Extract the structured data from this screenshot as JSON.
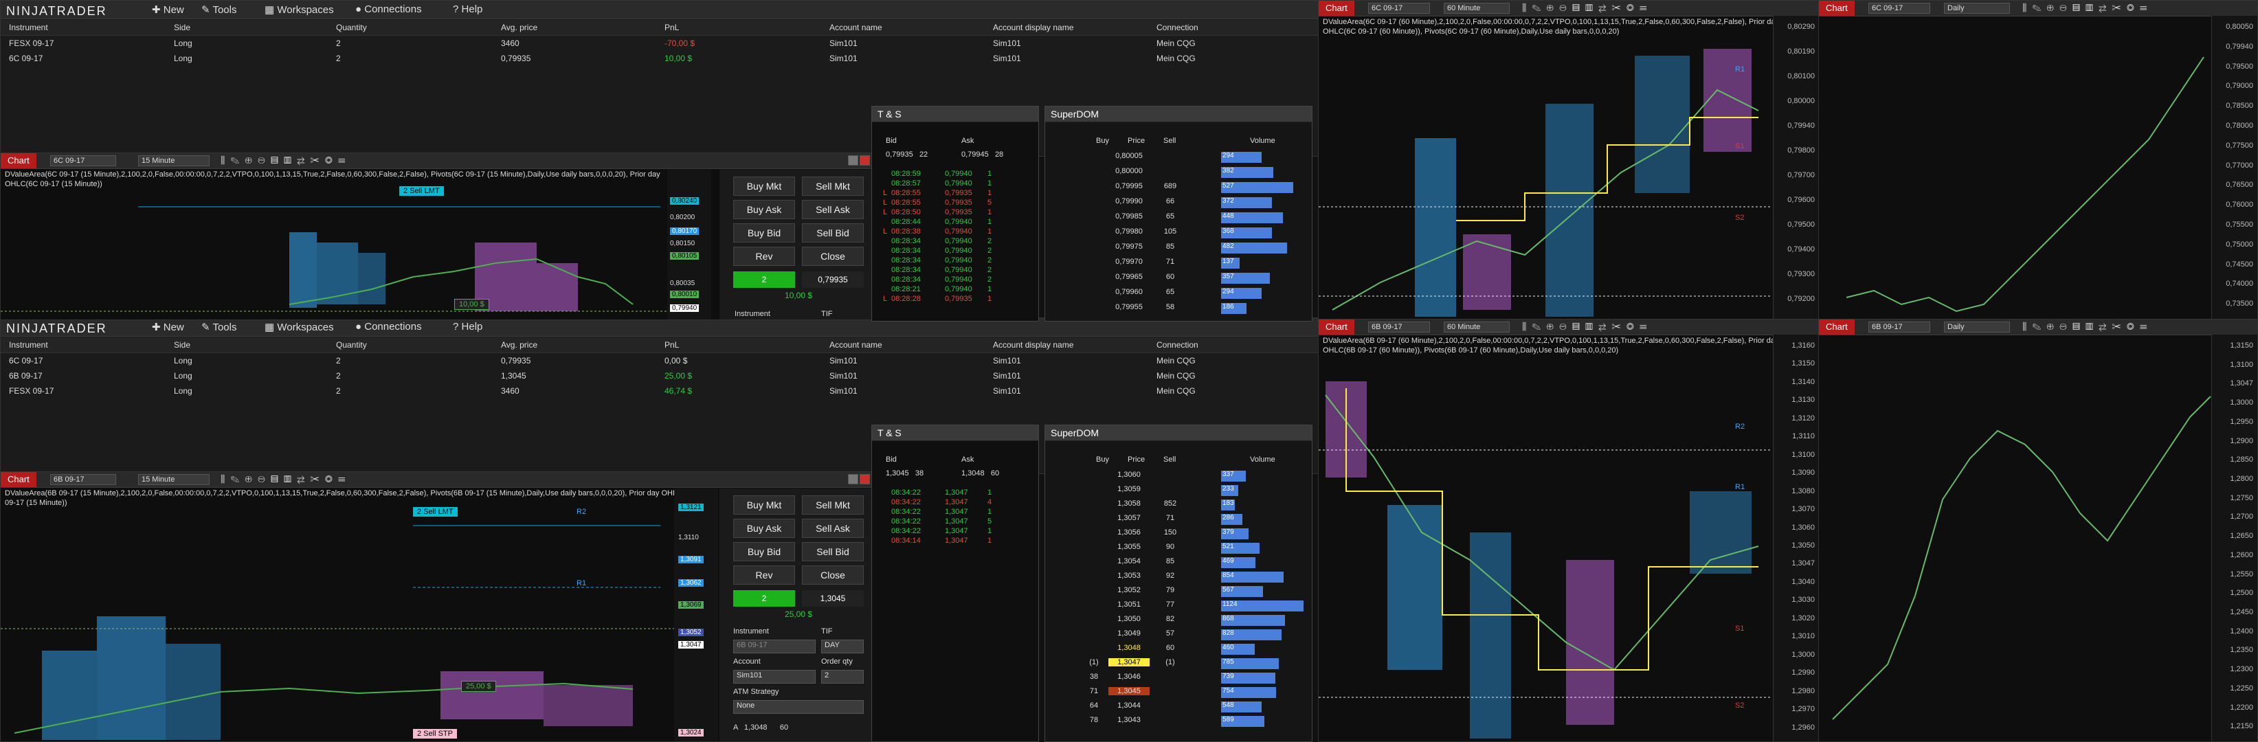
{
  "app": {
    "logo": "NINJATRADER"
  },
  "menu": {
    "new": "New",
    "tools": "Tools",
    "workspaces": "Workspaces",
    "connections": "Connections",
    "help": "Help"
  },
  "positions_columns": [
    "Instrument",
    "Side",
    "Quantity",
    "Avg. price",
    "PnL",
    "Account name",
    "Account display name",
    "Connection"
  ],
  "positions_top": [
    {
      "instrument": "FESX 09-17",
      "side": "Long",
      "qty": "2",
      "avg": "3460",
      "pnl": "-70,00 $",
      "account": "Sim101",
      "display": "Sim101",
      "conn": "Mein CQG"
    },
    {
      "instrument": "6C 09-17",
      "side": "Long",
      "qty": "2",
      "avg": "0,79935",
      "pnl": "10,00 $",
      "account": "Sim101",
      "display": "Sim101",
      "conn": "Mein CQG"
    }
  ],
  "positions_bottom": [
    {
      "instrument": "6C 09-17",
      "side": "Long",
      "qty": "2",
      "avg": "0,79935",
      "pnl": "0,00 $",
      "account": "Sim101",
      "display": "Sim101",
      "conn": "Mein CQG"
    },
    {
      "instrument": "6B 09-17",
      "side": "Long",
      "qty": "2",
      "avg": "1,3045",
      "pnl": "25,00 $",
      "account": "Sim101",
      "display": "Sim101",
      "conn": "Mein CQG"
    },
    {
      "instrument": "FESX 09-17",
      "side": "Long",
      "qty": "2",
      "avg": "3460",
      "pnl": "46,74 $",
      "account": "Sim101",
      "display": "Sim101",
      "conn": "Mein CQG"
    }
  ],
  "chart_tag": "Chart",
  "chart_tl": {
    "instrument": "6C 09-17",
    "interval": "15 Minute",
    "info1": "DValueArea(6C 09-17 (15 Minute),2,100,2,0,False,00:00:00,0,7,2,2,VTPO,0,100,1,13,15,True,2,False,0,60,300,False,2,False), Pivots(6C 09-17 (15 Minute),Daily,Use daily bars,0,0,0,20), Prior day",
    "info2": "OHLC(6C 09-17 (15 Minute))",
    "order_label": "2 Sell LMT",
    "pnl_label": "10,00 $",
    "axis": [
      "0,80240",
      "0,80200",
      "0,80170",
      "0,80150",
      "0,80105",
      "0,80035",
      "0,80010",
      "0,79940"
    ]
  },
  "chart_bl": {
    "instrument": "6B 09-17",
    "interval": "15 Minute",
    "info1": "DValueArea(6B 09-17 (15 Minute),2,100,2,0,False,00:00:00,0,7,2,2,VTPO,0,100,1,13,15,True,2,False,0,60,300,False,2,False), Pivots(6B 09-17 (15 Minute),Daily,Use daily bars,0,0,0,20), Prior day OHLC(6B",
    "info2": "09-17 (15 Minute))",
    "order_label": "2 Sell LMT",
    "stop_label": "2 Sell STP",
    "pnl_label": "25,00 $",
    "r1": "R1",
    "r2": "R2",
    "axis": [
      "1,3121",
      "1,3110",
      "1,3091",
      "1,3062",
      "1,3069",
      "1,3052",
      "1,3047",
      "1,3024"
    ]
  },
  "order_panel_top": {
    "buy_mkt": "Buy Mkt",
    "sell_mkt": "Sell Mkt",
    "buy_ask": "Buy Ask",
    "sell_ask": "Sell Ask",
    "buy_bid": "Buy Bid",
    "sell_bid": "Sell Bid",
    "rev": "Rev",
    "close": "Close",
    "qty": "2",
    "price": "0,79935",
    "pnl": "10,00 $",
    "instrument_label": "Instrument",
    "tif_label": "TIF"
  },
  "order_panel_bottom": {
    "buy_mkt": "Buy Mkt",
    "sell_mkt": "Sell Mkt",
    "buy_ask": "Buy Ask",
    "sell_ask": "Sell Ask",
    "buy_bid": "Buy Bid",
    "sell_bid": "Sell Bid",
    "rev": "Rev",
    "close": "Close",
    "qty": "2",
    "price": "1,3045",
    "pnl": "25,00 $",
    "instrument_label": "Instrument",
    "tif_label": "TIF",
    "instrument": "6B 09-17",
    "tif": "DAY",
    "account_label": "Account",
    "orderqty_label": "Order qty",
    "account": "Sim101",
    "orderqty": "2",
    "atm_label": "ATM Strategy",
    "atm": "None",
    "bottom_a": "A",
    "bottom_price": "1,3048",
    "bottom_qty": "60"
  },
  "ts_top": {
    "title": "T & S",
    "bid_label": "Bid",
    "ask_label": "Ask",
    "bid": "0,79935",
    "bid_size": "22",
    "ask": "0,79945",
    "ask_size": "28",
    "rows": [
      {
        "flag": "",
        "time": "08:28:59",
        "price": "0,79940",
        "size": "1",
        "c": "green"
      },
      {
        "flag": "",
        "time": "08:28:57",
        "price": "0,79940",
        "size": "1",
        "c": "green"
      },
      {
        "flag": "L",
        "time": "08:28:55",
        "price": "0,79935",
        "size": "1",
        "c": "red"
      },
      {
        "flag": "L",
        "time": "08:28:55",
        "price": "0,79935",
        "size": "5",
        "c": "red"
      },
      {
        "flag": "L",
        "time": "08:28:50",
        "price": "0,79935",
        "size": "1",
        "c": "red"
      },
      {
        "flag": "",
        "time": "08:28:44",
        "price": "0,79940",
        "size": "1",
        "c": "green"
      },
      {
        "flag": "L",
        "time": "08:28:38",
        "price": "0,79940",
        "size": "1",
        "c": "red"
      },
      {
        "flag": "",
        "time": "08:28:34",
        "price": "0,79940",
        "size": "2",
        "c": "green"
      },
      {
        "flag": "",
        "time": "08:28:34",
        "price": "0,79940",
        "size": "2",
        "c": "green"
      },
      {
        "flag": "",
        "time": "08:28:34",
        "price": "0,79940",
        "size": "2",
        "c": "green"
      },
      {
        "flag": "",
        "time": "08:28:34",
        "price": "0,79940",
        "size": "2",
        "c": "green"
      },
      {
        "flag": "",
        "time": "08:28:34",
        "price": "0,79940",
        "size": "2",
        "c": "green"
      },
      {
        "flag": "",
        "time": "08:28:21",
        "price": "0,79940",
        "size": "1",
        "c": "green"
      },
      {
        "flag": "L",
        "time": "08:28:28",
        "price": "0,79935",
        "size": "1",
        "c": "red"
      }
    ]
  },
  "ts_bottom": {
    "title": "T & S",
    "bid_label": "Bid",
    "ask_label": "Ask",
    "bid": "1,3045",
    "bid_size": "38",
    "ask": "1,3048",
    "ask_size": "60",
    "rows": [
      {
        "flag": "",
        "time": "08:34:22",
        "price": "1,3047",
        "size": "1",
        "c": "green"
      },
      {
        "flag": "",
        "time": "08:34:22",
        "price": "1,3047",
        "size": "4",
        "c": "red"
      },
      {
        "flag": "",
        "time": "08:34:22",
        "price": "1,3047",
        "size": "1",
        "c": "green"
      },
      {
        "flag": "",
        "time": "08:34:22",
        "price": "1,3047",
        "size": "5",
        "c": "green"
      },
      {
        "flag": "",
        "time": "08:34:22",
        "price": "1,3047",
        "size": "1",
        "c": "green"
      },
      {
        "flag": "",
        "time": "08:34:14",
        "price": "1,3047",
        "size": "1",
        "c": "red"
      }
    ]
  },
  "dom_top": {
    "title": "SuperDOM",
    "buy_label": "Buy",
    "price_label": "Price",
    "sell_label": "Sell",
    "volume_label": "Volume",
    "rows": [
      {
        "price": "0,80005",
        "sell": "",
        "vol": "294"
      },
      {
        "price": "0,80000",
        "sell": "",
        "vol": "382"
      },
      {
        "price": "0,79995",
        "sell": "689",
        "vol": "527"
      },
      {
        "price": "0,79990",
        "sell": "66",
        "vol": "372"
      },
      {
        "price": "0,79985",
        "sell": "65",
        "vol": "448"
      },
      {
        "price": "0,79980",
        "sell": "105",
        "vol": "368"
      },
      {
        "price": "0,79975",
        "sell": "85",
        "vol": "482"
      },
      {
        "price": "0,79970",
        "sell": "71",
        "vol": "137"
      },
      {
        "price": "0,79965",
        "sell": "60",
        "vol": "357"
      },
      {
        "price": "0,79960",
        "sell": "65",
        "vol": "294"
      },
      {
        "price": "0,79955",
        "sell": "58",
        "vol": "186"
      }
    ]
  },
  "dom_bottom": {
    "title": "SuperDOM",
    "buy_label": "Buy",
    "price_label": "Price",
    "sell_label": "Sell",
    "volume_label": "Volume",
    "rows": [
      {
        "buy": "",
        "price": "1,3060",
        "sell": "",
        "vol": "337"
      },
      {
        "buy": "",
        "price": "1,3059",
        "sell": "",
        "vol": "233"
      },
      {
        "buy": "",
        "price": "1,3058",
        "sell": "852",
        "vol": "183"
      },
      {
        "buy": "",
        "price": "1,3057",
        "sell": "71",
        "vol": "286"
      },
      {
        "buy": "",
        "price": "1,3056",
        "sell": "150",
        "vol": "379"
      },
      {
        "buy": "",
        "price": "1,3055",
        "sell": "90",
        "vol": "521"
      },
      {
        "buy": "",
        "price": "1,3054",
        "sell": "85",
        "vol": "469"
      },
      {
        "buy": "",
        "price": "1,3053",
        "sell": "92",
        "vol": "854"
      },
      {
        "buy": "",
        "price": "1,3052",
        "sell": "79",
        "vol": "567"
      },
      {
        "buy": "",
        "price": "1,3051",
        "sell": "77",
        "vol": "1124"
      },
      {
        "buy": "",
        "price": "1,3050",
        "sell": "82",
        "vol": "868"
      },
      {
        "buy": "",
        "price": "1,3049",
        "sell": "57",
        "vol": "828"
      },
      {
        "buy": "",
        "price": "1,3048",
        "sell": "60",
        "vol": "460"
      },
      {
        "buy": "(1)",
        "price": "1,3047",
        "sell": "(1)",
        "vol": "785"
      },
      {
        "buy": "38",
        "price": "1,3046",
        "sell": "",
        "vol": "739"
      },
      {
        "buy": "71",
        "price": "1,3045",
        "sell": "",
        "vol": "754"
      },
      {
        "buy": "64",
        "price": "1,3044",
        "sell": "",
        "vol": "548"
      },
      {
        "buy": "78",
        "price": "1,3043",
        "sell": "",
        "vol": "589"
      }
    ]
  },
  "chart_tr60": {
    "instrument": "6C 09-17",
    "interval": "60 Minute",
    "info1": "DValueArea(6C 09-17 (60 Minute),2,100,2,0,False,00:00:00,0,7,2,2,VTPO,0,100,1,13,15,True,2,False,0,60,300,False,2,False), Prior day",
    "info2": "OHLC(6C 09-17 (60 Minute)), Pivots(6C 09-17 (60 Minute),Daily,Use daily bars,0,0,0,20)",
    "r1": "R1",
    "s1": "S1",
    "s2": "S2",
    "axis": [
      "0,80290",
      "0,80190",
      "0,80100",
      "0,80000",
      "0,79940",
      "0,79800",
      "0,79700",
      "0,79600",
      "0,79500",
      "0,79400",
      "0,79300",
      "0,79200"
    ]
  },
  "chart_br60": {
    "instrument": "6B 09-17",
    "interval": "60 Minute",
    "info1": "DValueArea(6B 09-17 (60 Minute),2,100,2,0,False,00:00:00,0,7,2,2,VTPO,0,100,1,13,15,True,2,False,0,60,300,False,2,False), Prior day",
    "info2": "OHLC(6B 09-17 (60 Minute)), Pivots(6B 09-17 (60 Minute),Daily,Use daily bars,0,0,0,20)",
    "r1": "R1",
    "r2": "R2",
    "s1": "S1",
    "s2": "S2",
    "axis": [
      "1,3160",
      "1,3150",
      "1,3140",
      "1,3130",
      "1,3120",
      "1,3110",
      "1,3100",
      "1,3090",
      "1,3080",
      "1,3070",
      "1,3060",
      "1,3050",
      "1,3047",
      "1,3040",
      "1,3030",
      "1,3020",
      "1,3010",
      "1,3000",
      "1,2990",
      "1,2980",
      "1,2970",
      "1,2960"
    ]
  },
  "chart_trd": {
    "instrument": "6C 09-17",
    "interval": "Daily",
    "axis": [
      "0,80050",
      "0,79940",
      "0,79500",
      "0,79000",
      "0,78500",
      "0,78000",
      "0,77500",
      "0,77000",
      "0,76500",
      "0,76000",
      "0,75500",
      "0,75000",
      "0,74500",
      "0,74000",
      "0,73500"
    ]
  },
  "chart_brd": {
    "instrument": "6B 09-17",
    "interval": "Daily",
    "axis": [
      "1,3150",
      "1,3100",
      "1,3047",
      "1,3000",
      "1,2950",
      "1,2900",
      "1,2850",
      "1,2800",
      "1,2750",
      "1,2700",
      "1,2650",
      "1,2600",
      "1,2550",
      "1,2500",
      "1,2450",
      "1,2400",
      "1,2350",
      "1,2300",
      "1,2250",
      "1,2200",
      "1,2150"
    ]
  }
}
